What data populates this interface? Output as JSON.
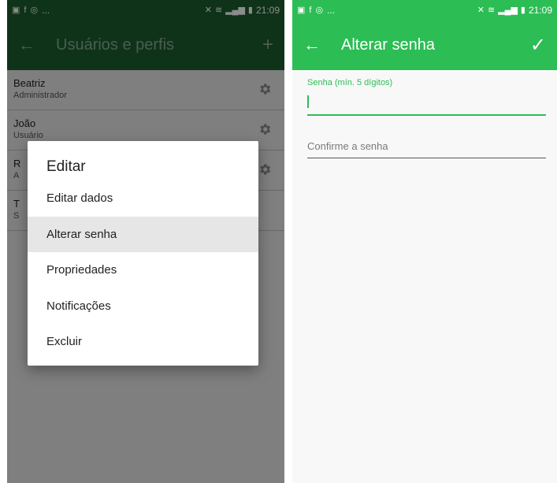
{
  "left_screen": {
    "status_bar": {
      "time": "21:09",
      "notifications": "..."
    },
    "app_bar": {
      "title": "Usuários e perfis",
      "back_icon": "arrow-left-icon",
      "action_icon": "plus-icon"
    },
    "users": [
      {
        "name": "Beatriz",
        "role": "Administrador"
      },
      {
        "name": "João",
        "role": "Usuário"
      },
      {
        "name": "R",
        "role": "A"
      },
      {
        "name": "T",
        "role": "S"
      }
    ],
    "dialog": {
      "title": "Editar",
      "items": [
        "Editar dados",
        "Alterar senha",
        "Propriedades",
        "Notificações",
        "Excluir"
      ],
      "highlighted": "Alterar senha"
    }
  },
  "right_screen": {
    "status_bar": {
      "time": "21:09",
      "notifications": "..."
    },
    "app_bar": {
      "title": "Alterar senha",
      "back_icon": "arrow-left-icon",
      "action_icon": "check-icon"
    },
    "password_field": {
      "label": "Senha (mín. 5 dígitos)",
      "value": ""
    },
    "confirm_field": {
      "placeholder": "Confirme a senha",
      "value": ""
    }
  },
  "colors": {
    "primary": "#2cbd55",
    "primary_dark_dimmed": "#1a5e2e",
    "dialog_highlight": "#e6e6e6"
  }
}
